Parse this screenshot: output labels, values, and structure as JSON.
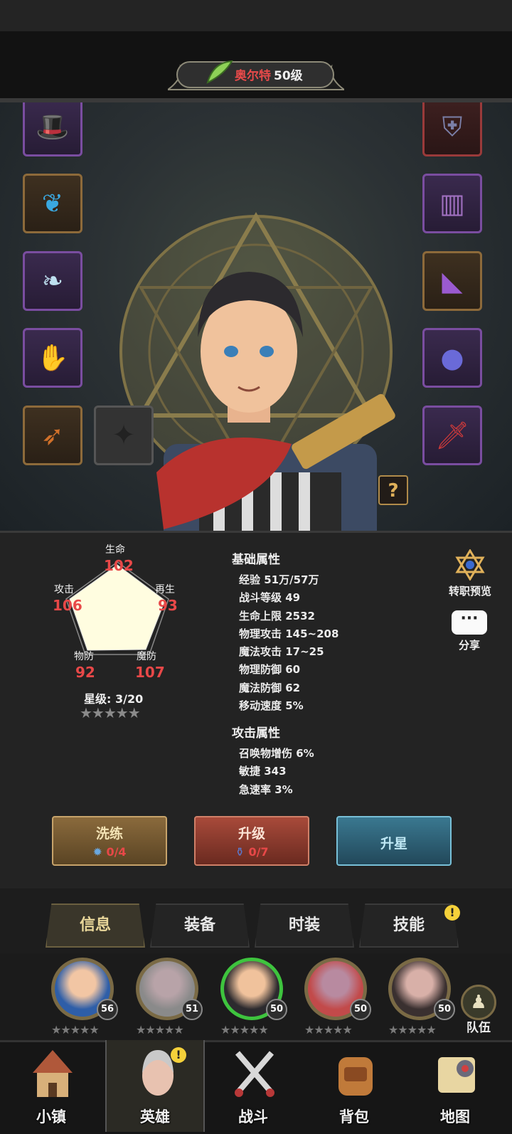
{
  "header": {
    "hero_name": "奥尔特",
    "hero_level": "50级"
  },
  "equipment_left": [
    {
      "name": "hat-icon",
      "rarity": "purple"
    },
    {
      "name": "necklace-icon",
      "rarity": "orange"
    },
    {
      "name": "wings-charm-icon",
      "rarity": "purple"
    },
    {
      "name": "gauntlet-icon",
      "rarity": "purple"
    },
    {
      "name": "bow-icon",
      "rarity": "orange"
    }
  ],
  "equipment_right": [
    {
      "name": "armor-icon",
      "rarity": "red"
    },
    {
      "name": "pants-icon",
      "rarity": "purple"
    },
    {
      "name": "boots-icon",
      "rarity": "orange"
    },
    {
      "name": "ring-icon",
      "rarity": "purple"
    },
    {
      "name": "dagger-icon",
      "rarity": "purple"
    }
  ],
  "radar": {
    "life": {
      "label": "生命",
      "value": "102"
    },
    "regen": {
      "label": "再生",
      "value": "93"
    },
    "mdef": {
      "label": "魔防",
      "value": "107"
    },
    "pdef": {
      "label": "物防",
      "value": "92"
    },
    "attack": {
      "label": "攻击",
      "value": "106"
    }
  },
  "star_level": "星级: 3/20",
  "base_attributes": {
    "title": "基础属性",
    "lines": [
      "经验 51万/57万",
      "战斗等级 49",
      "生命上限 2532",
      "物理攻击 145~208",
      "魔法攻击 17~25",
      "物理防御 60",
      "魔法防御 62",
      "移动速度 5%"
    ]
  },
  "attack_attributes": {
    "title": "攻击属性",
    "lines": [
      "召唤物增伤 6%",
      "敏捷 343",
      "急速率 3%"
    ]
  },
  "side_actions": {
    "class_preview": "转职预览",
    "share": "分享"
  },
  "buttons": {
    "refine": {
      "label": "洗练",
      "count": "0/4"
    },
    "upgrade": {
      "label": "升级",
      "count": "0/7"
    },
    "star_up": {
      "label": "升星"
    }
  },
  "tabs": [
    "信息",
    "装备",
    "时装",
    "技能"
  ],
  "roster": [
    {
      "level": "56",
      "stars": "★★★★★"
    },
    {
      "level": "51",
      "stars": "★★★★★"
    },
    {
      "level": "50",
      "stars": "★★★★★"
    },
    {
      "level": "50",
      "stars": "★★★★★"
    },
    {
      "level": "50",
      "stars": "★★★★★"
    }
  ],
  "team_label": "队伍",
  "nav": [
    "小镇",
    "英雄",
    "战斗",
    "背包",
    "地图"
  ],
  "colors": {
    "accent_red": "#e84848",
    "gold": "#e0b15a",
    "selected_ring": "#3ec43e"
  }
}
